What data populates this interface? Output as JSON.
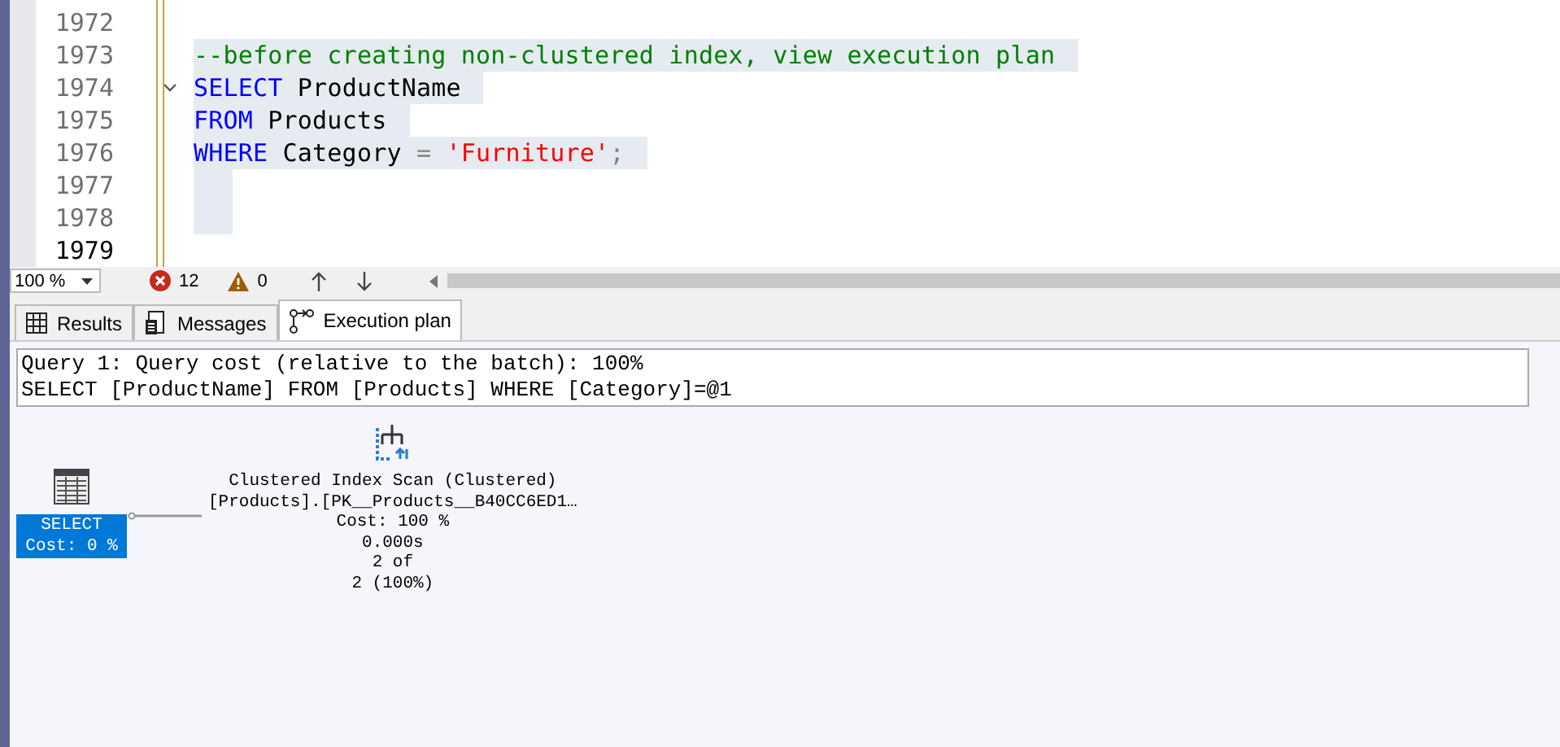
{
  "editor": {
    "lines": [
      {
        "number": "1972",
        "selected": false,
        "current": false
      },
      {
        "number": "1973",
        "selected": true,
        "current": false,
        "tokens": [
          {
            "kind": "comment",
            "text": "--before creating non-clustered index, view execution plan"
          }
        ]
      },
      {
        "number": "1974",
        "selected": true,
        "current": false,
        "fold": true,
        "tokens": [
          {
            "kind": "keyword",
            "text": "SELECT"
          },
          {
            "kind": "plain",
            "text": " ProductName"
          }
        ]
      },
      {
        "number": "1975",
        "selected": true,
        "current": false,
        "tokens": [
          {
            "kind": "keyword",
            "text": "FROM"
          },
          {
            "kind": "plain",
            "text": " Products"
          }
        ]
      },
      {
        "number": "1976",
        "selected": true,
        "current": false,
        "tokens": [
          {
            "kind": "keyword",
            "text": "WHERE"
          },
          {
            "kind": "plain",
            "text": " Category "
          },
          {
            "kind": "operator",
            "text": "= "
          },
          {
            "kind": "string",
            "text": "'Furniture'"
          },
          {
            "kind": "operator",
            "text": ";"
          }
        ]
      },
      {
        "number": "1977",
        "selected": true,
        "current": false
      },
      {
        "number": "1978",
        "selected": true,
        "current": false
      },
      {
        "number": "1979",
        "selected": false,
        "current": true
      }
    ]
  },
  "status_bar": {
    "zoom": "100 %",
    "errors": "12",
    "warnings": "0"
  },
  "tabs": [
    {
      "label": "Results",
      "selected": false
    },
    {
      "label": "Messages",
      "selected": false
    },
    {
      "label": "Execution plan",
      "selected": true
    }
  ],
  "plan": {
    "header": [
      "Query 1: Query cost (relative to the batch): 100%",
      "SELECT [ProductName] FROM [Products] WHERE [Category]=@1"
    ],
    "nodes": [
      {
        "kind": "select",
        "selected": true,
        "lines": [
          "SELECT",
          "Cost: 0 %"
        ]
      },
      {
        "kind": "scan",
        "selected": false,
        "lines": [
          "Clustered Index Scan (Clustered)",
          "[Products].[PK__Products__B40CC6ED1…",
          "Cost: 100 %",
          "0.000s",
          "2 of",
          "2 (100%)"
        ]
      }
    ]
  }
}
